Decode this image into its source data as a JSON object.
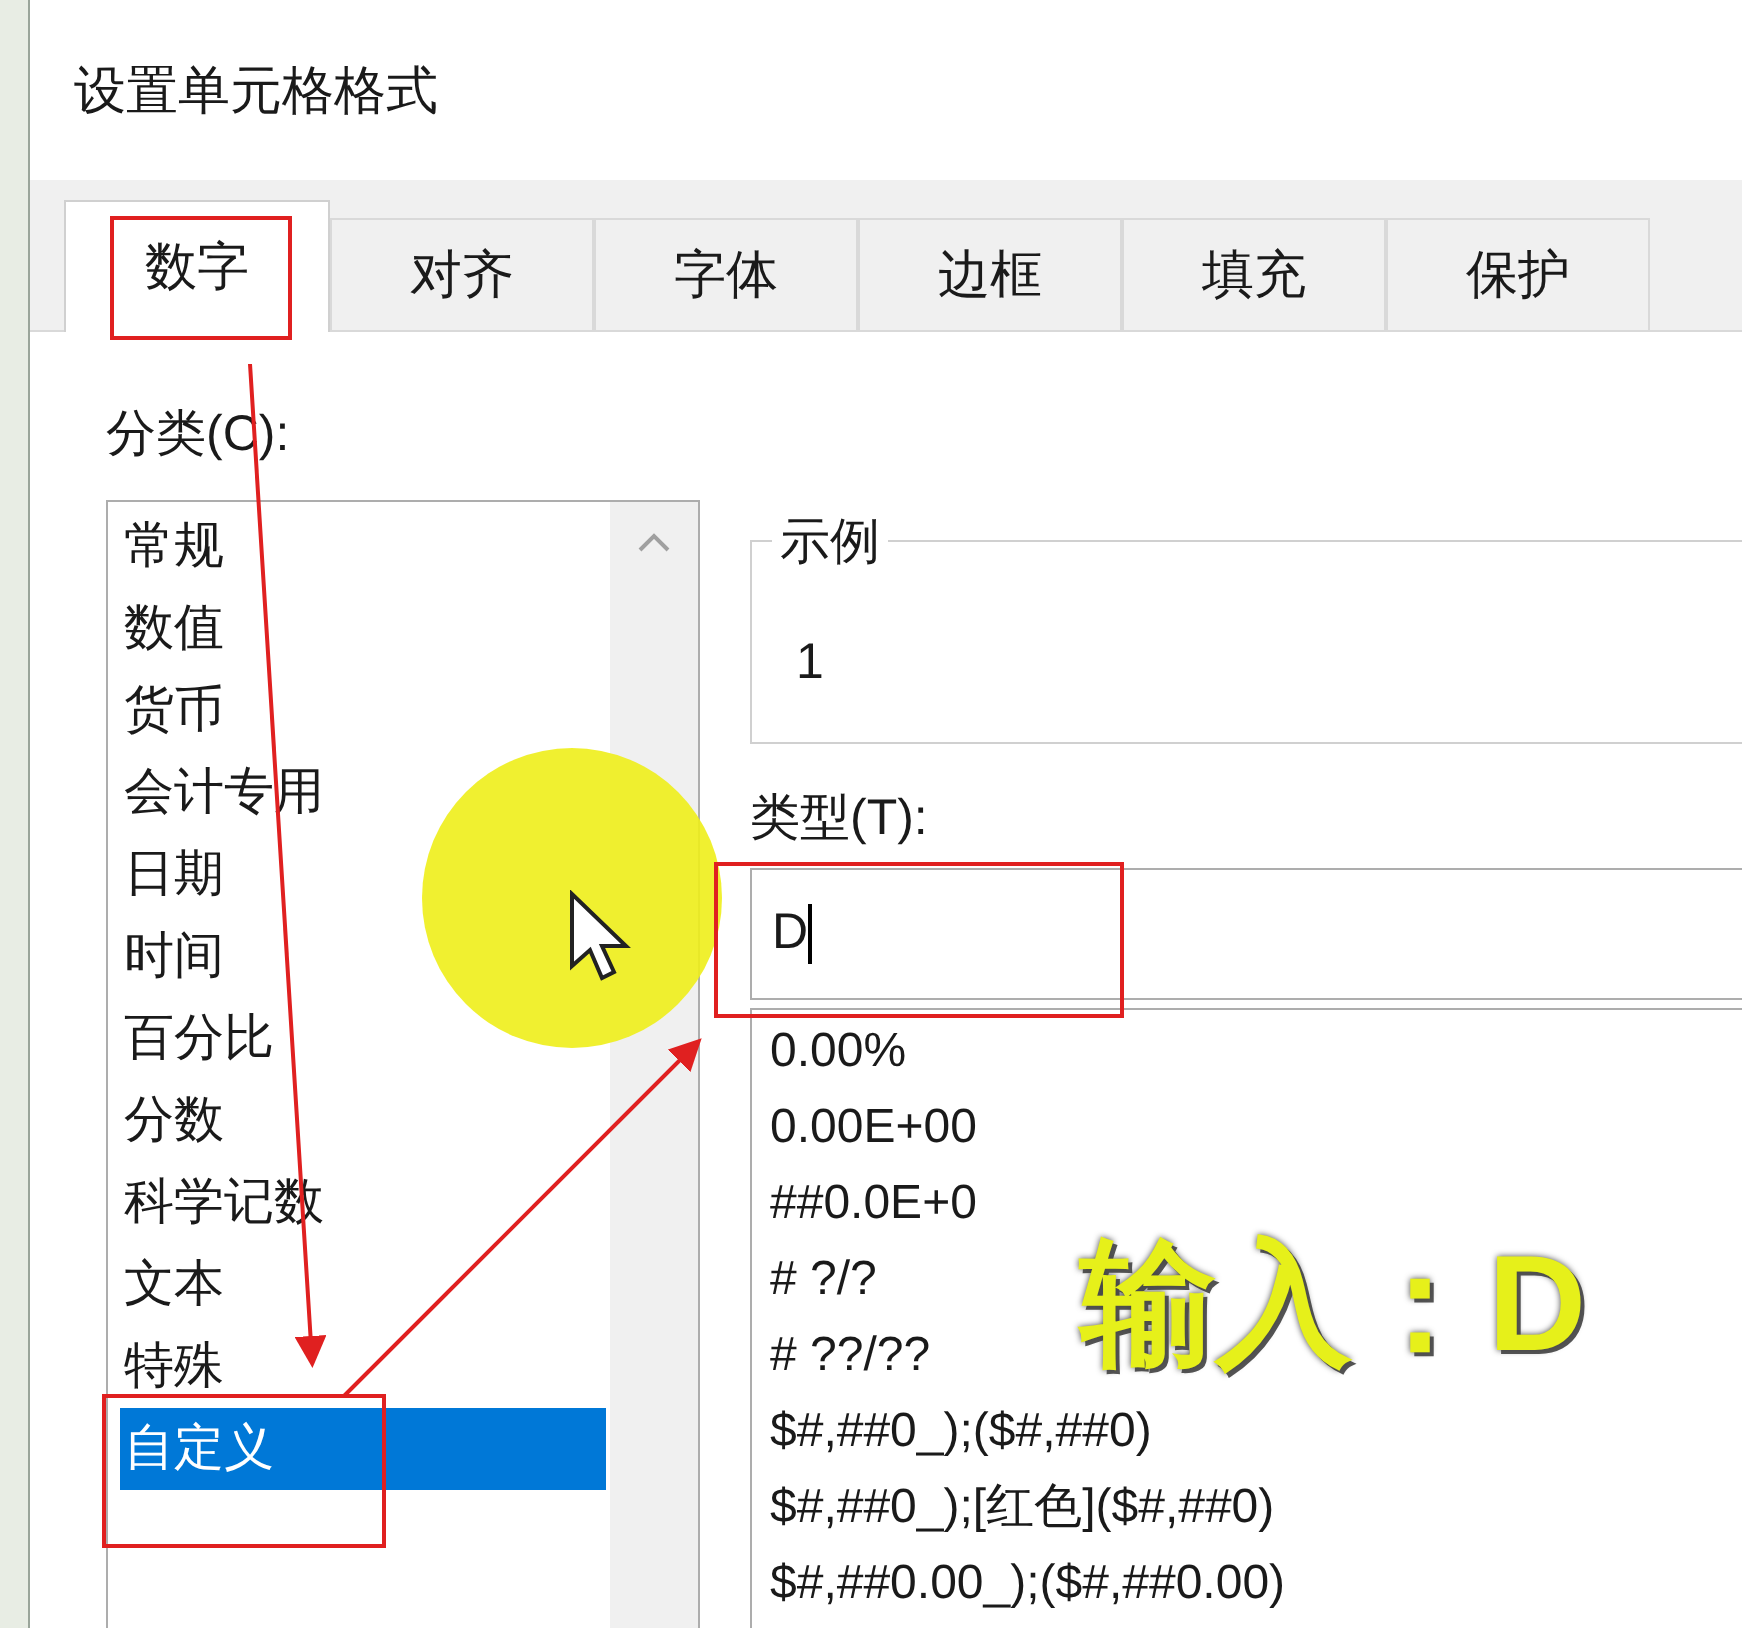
{
  "window": {
    "title": "设置单元格格式"
  },
  "tabs": [
    {
      "label": "数字",
      "selected": true
    },
    {
      "label": "对齐",
      "selected": false
    },
    {
      "label": "字体",
      "selected": false
    },
    {
      "label": "边框",
      "selected": false
    },
    {
      "label": "填充",
      "selected": false
    },
    {
      "label": "保护",
      "selected": false
    }
  ],
  "category": {
    "label": "分类(C):",
    "items": [
      {
        "label": "常规",
        "selected": false
      },
      {
        "label": "数值",
        "selected": false
      },
      {
        "label": "货币",
        "selected": false
      },
      {
        "label": "会计专用",
        "selected": false
      },
      {
        "label": "日期",
        "selected": false
      },
      {
        "label": "时间",
        "selected": false
      },
      {
        "label": "百分比",
        "selected": false
      },
      {
        "label": "分数",
        "selected": false
      },
      {
        "label": "科学记数",
        "selected": false
      },
      {
        "label": "文本",
        "selected": false
      },
      {
        "label": "特殊",
        "selected": false
      },
      {
        "label": "自定义",
        "selected": true
      }
    ]
  },
  "sample": {
    "legend": "示例",
    "value": "1"
  },
  "type": {
    "label": "类型(T):",
    "value": "D",
    "formats": [
      "0.00%",
      "0.00E+00",
      "##0.0E+0",
      "# ?/?",
      "# ??/??",
      "$#,##0_);($#,##0)",
      "$#,##0_);[红色]($#,##0)",
      "$#,##0.00_);($#,##0.00)"
    ]
  },
  "caption": "输入：D"
}
